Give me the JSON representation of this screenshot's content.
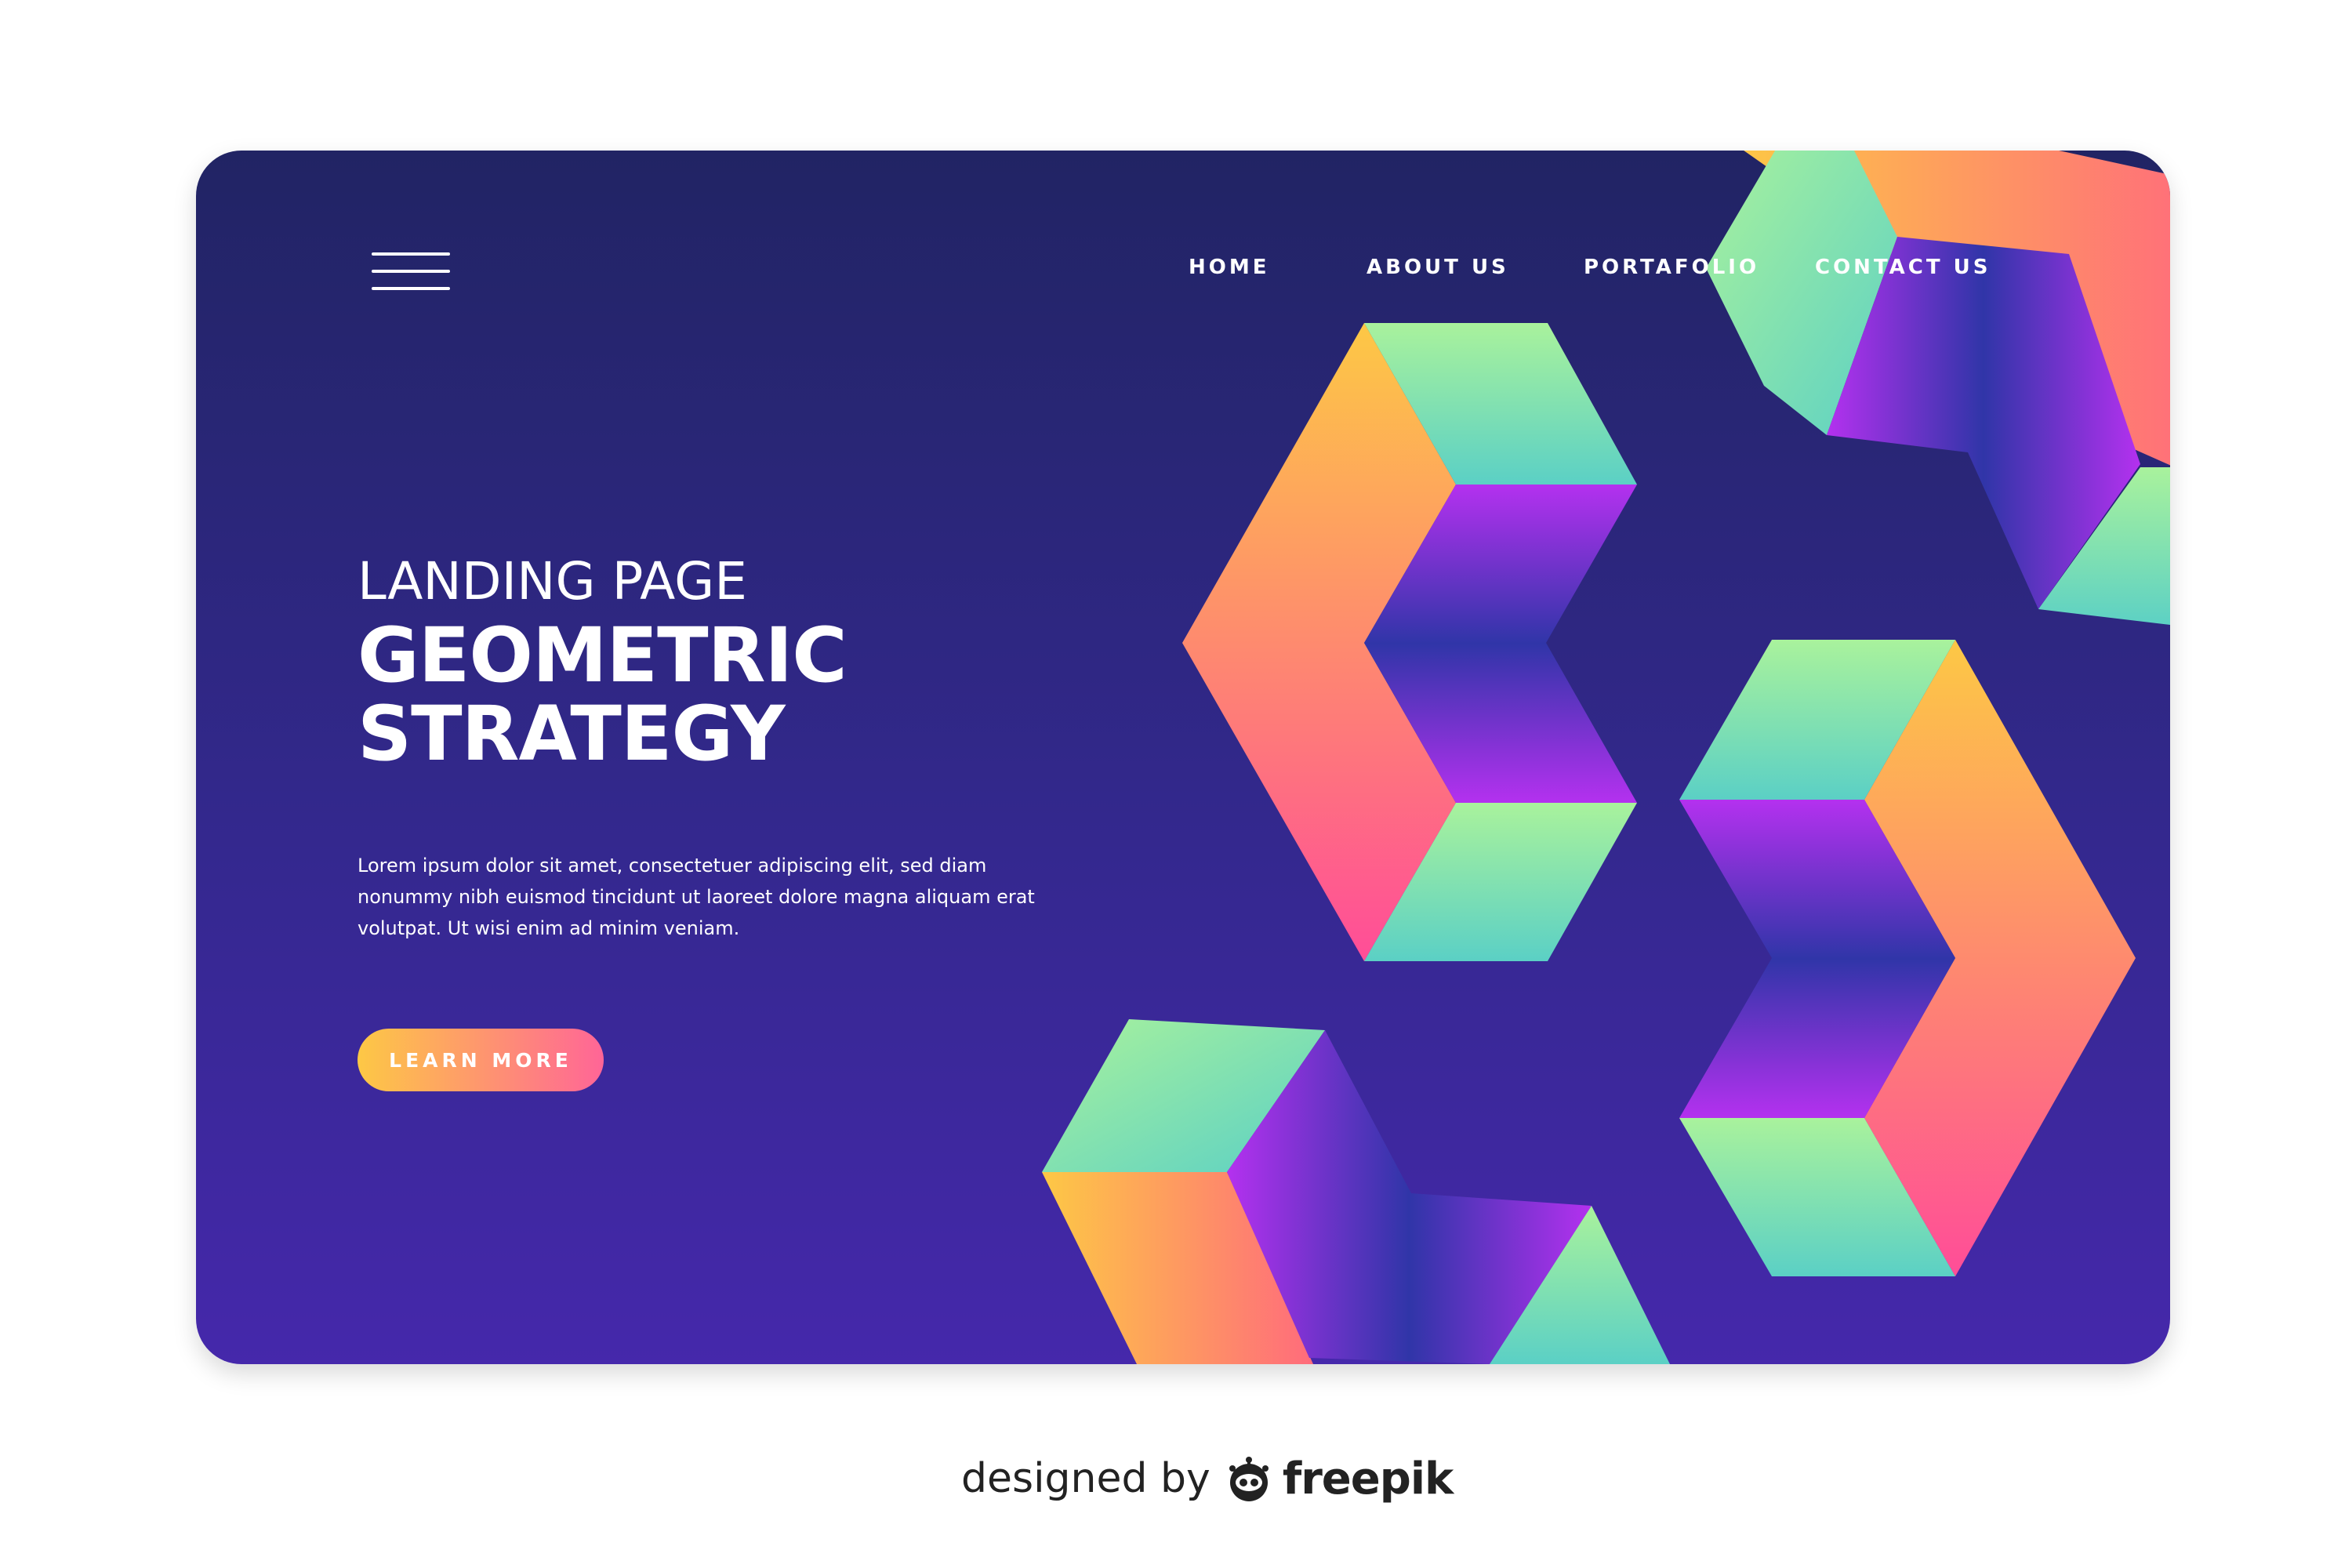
{
  "menu": {
    "icon": "hamburger-menu-icon"
  },
  "nav": {
    "items": [
      {
        "label": "HOME"
      },
      {
        "label": "ABOUT US"
      },
      {
        "label": "PORTAFOLIO"
      },
      {
        "label": "CONTACT US"
      }
    ]
  },
  "hero": {
    "kicker": "LANDING PAGE",
    "title_line1": "GEOMETRIC",
    "title_line2": "STRATEGY",
    "body": "Lorem ipsum dolor sit amet, consectetuer adipiscing elit, sed diam nonummy nibh euismod tincidunt ut laoreet dolore magna aliquam erat volutpat. Ut wisi enim ad minim veniam.",
    "cta_label": "LEARN MORE"
  },
  "credit": {
    "prefix": "designed by",
    "brand": "freepik",
    "logo_icon": "freepik-logo-icon"
  },
  "colors": {
    "background_top": "#212464",
    "background_bottom": "#4528ab",
    "gradient_yellow": "#fdc845",
    "gradient_pink": "#ff4d98",
    "gradient_green": "#a9f29c",
    "gradient_teal": "#5bd0c5",
    "gradient_purple": "#b431ef",
    "gradient_indigo": "#3035a8"
  }
}
